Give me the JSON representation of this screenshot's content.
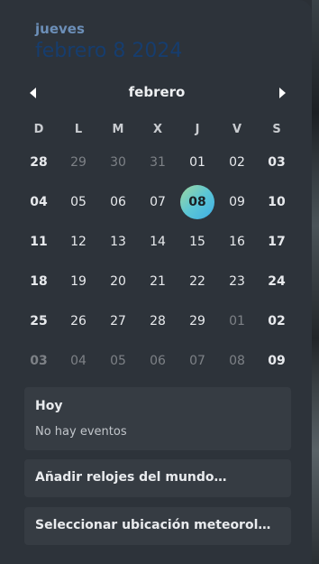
{
  "header": {
    "weekday": "jueves",
    "full_date": "febrero 8 2024"
  },
  "calendar": {
    "month": "febrero",
    "days_of_week": [
      "D",
      "L",
      "M",
      "X",
      "J",
      "V",
      "S"
    ],
    "weeks": [
      [
        {
          "d": "28",
          "other": false
        },
        {
          "d": "29",
          "other": true
        },
        {
          "d": "30",
          "other": true
        },
        {
          "d": "31",
          "other": true
        },
        {
          "d": "01",
          "other": false
        },
        {
          "d": "02",
          "other": false
        },
        {
          "d": "03",
          "other": false
        }
      ],
      [
        {
          "d": "04",
          "other": false
        },
        {
          "d": "05",
          "other": false
        },
        {
          "d": "06",
          "other": false
        },
        {
          "d": "07",
          "other": false
        },
        {
          "d": "08",
          "other": false,
          "today": true
        },
        {
          "d": "09",
          "other": false
        },
        {
          "d": "10",
          "other": false
        }
      ],
      [
        {
          "d": "11",
          "other": false
        },
        {
          "d": "12",
          "other": false
        },
        {
          "d": "13",
          "other": false
        },
        {
          "d": "14",
          "other": false
        },
        {
          "d": "15",
          "other": false
        },
        {
          "d": "16",
          "other": false
        },
        {
          "d": "17",
          "other": false
        }
      ],
      [
        {
          "d": "18",
          "other": false
        },
        {
          "d": "19",
          "other": false
        },
        {
          "d": "20",
          "other": false
        },
        {
          "d": "21",
          "other": false
        },
        {
          "d": "22",
          "other": false
        },
        {
          "d": "23",
          "other": false
        },
        {
          "d": "24",
          "other": false
        }
      ],
      [
        {
          "d": "25",
          "other": false
        },
        {
          "d": "26",
          "other": false
        },
        {
          "d": "27",
          "other": false
        },
        {
          "d": "28",
          "other": false
        },
        {
          "d": "29",
          "other": false
        },
        {
          "d": "01",
          "other": true
        },
        {
          "d": "02",
          "other": false
        }
      ],
      [
        {
          "d": "03",
          "other": true
        },
        {
          "d": "04",
          "other": true
        },
        {
          "d": "05",
          "other": true
        },
        {
          "d": "06",
          "other": true
        },
        {
          "d": "07",
          "other": true
        },
        {
          "d": "08",
          "other": true
        },
        {
          "d": "09",
          "other": false
        }
      ]
    ]
  },
  "events": {
    "title": "Hoy",
    "empty_text": "No hay eventos"
  },
  "clocks": {
    "label": "Añadir relojes del mundo…"
  },
  "weather": {
    "label": "Seleccionar ubicación meteorológi…"
  },
  "icons": {
    "prev": "chevron-left-icon",
    "next": "chevron-right-icon"
  },
  "colors": {
    "today_gradient_start": "#9ed79e",
    "today_gradient_end": "#3eaee6",
    "panel_bg": "#2d333a"
  }
}
